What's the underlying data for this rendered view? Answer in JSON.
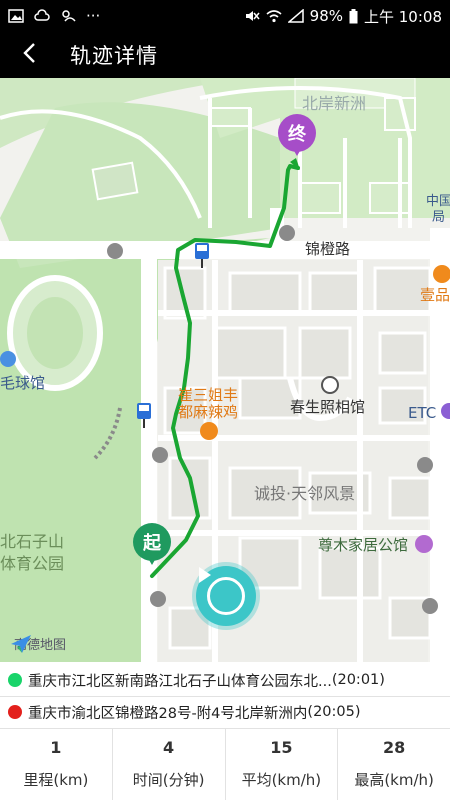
{
  "status_bar": {
    "battery": "98%",
    "time": "上午 10:08",
    "dots": "···",
    "icons": [
      "image-icon",
      "cloud-icon",
      "weather-icon",
      "mute-icon",
      "wifi-icon",
      "signal-icon",
      "battery-icon"
    ]
  },
  "header": {
    "title": "轨迹详情",
    "back_icon": "chevron-left-icon"
  },
  "map": {
    "labels": {
      "north_shore": "北岸新洲",
      "jincheng_road": "锦橙路",
      "chongqing": "中国",
      "bureau": "局",
      "yipin": "壹品",
      "tennis": "毛球馆",
      "cuisanjie_1": "崔三姐丰",
      "cuisanjie_2": "都麻辣鸡",
      "chunsheng": "春生照相馆",
      "etc": "ETC",
      "chengtou": "诚投·天邻风景",
      "zunmu": "尊木家居公馆",
      "park_1": "北石子山",
      "park_2": "体育公园"
    },
    "start_marker": "起",
    "end_marker": "终",
    "logo": "高德地图",
    "colors": {
      "route": "#1aa632",
      "start": "#1f9a5f",
      "end": "#a64dc8",
      "play": "#3cc6c8"
    }
  },
  "trip": {
    "start_address": "重庆市江北区新南路江北石子山体育公园东北...",
    "start_time": "(20:01)",
    "end_address": "重庆市渝北区锦橙路28号-附4号北岸新洲内",
    "end_time": "(20:05)",
    "start_dot_color": "#19d46a",
    "end_dot_color": "#e3201c"
  },
  "stats": [
    {
      "value": "1",
      "label": "里程(km)"
    },
    {
      "value": "4",
      "label": "时间(分钟)"
    },
    {
      "value": "15",
      "label": "平均(km/h)"
    },
    {
      "value": "28",
      "label": "最高(km/h)"
    }
  ]
}
